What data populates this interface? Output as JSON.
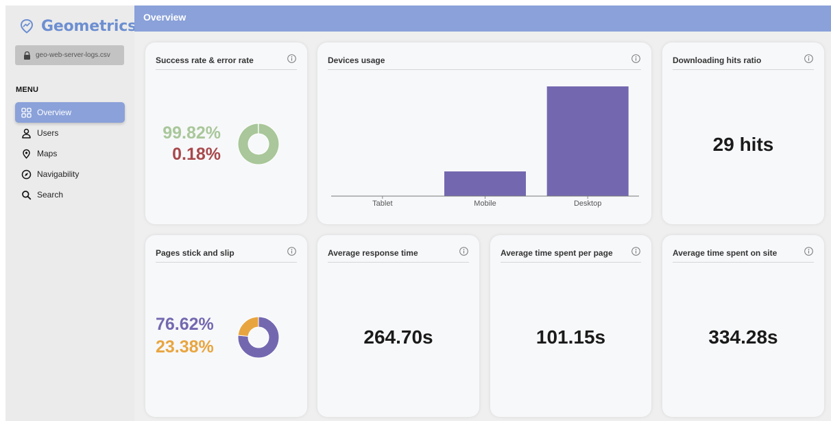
{
  "app": {
    "brand": "Geometrics",
    "file_name": "geo-web-server-logs.csv",
    "menu_heading": "MENU"
  },
  "sidebar": {
    "items": [
      {
        "label": "Overview",
        "icon": "grid-icon",
        "active": true
      },
      {
        "label": "Users",
        "icon": "user-icon",
        "active": false
      },
      {
        "label": "Maps",
        "icon": "map-pin-icon",
        "active": false
      },
      {
        "label": "Navigability",
        "icon": "compass-icon",
        "active": false
      },
      {
        "label": "Search",
        "icon": "search-icon",
        "active": false
      }
    ]
  },
  "header": {
    "title": "Overview"
  },
  "cards": {
    "success": {
      "title": "Success rate & error rate",
      "success_rate": "99.82%",
      "error_rate": "0.18%"
    },
    "devices": {
      "title": "Devices usage"
    },
    "downloading": {
      "title": "Downloading hits ratio",
      "value": "29 hits"
    },
    "pages": {
      "title": "Pages stick and slip",
      "stick": "76.62%",
      "slip": "23.38%"
    },
    "response": {
      "title": "Average response time",
      "value": "264.70s"
    },
    "time_per_page": {
      "title": "Average time spent per page",
      "value": "101.15s"
    },
    "time_on_site": {
      "title": "Average time spent on site",
      "value": "334.28s"
    }
  },
  "colors": {
    "brand": "#6d8fd1",
    "header": "#8aa1d9",
    "success": "#a9c79a",
    "error": "#a8484b",
    "stick": "#7368b0",
    "slip": "#e8a53f",
    "bar": "#7368b0"
  },
  "chart_data": [
    {
      "type": "bar",
      "categories": [
        "Tablet",
        "Mobile",
        "Desktop"
      ],
      "values": [
        0,
        22.5,
        100
      ],
      "ylim": [
        0,
        100
      ]
    },
    {
      "type": "pie",
      "categories": [
        "Success",
        "Error"
      ],
      "values": [
        99.82,
        0.18
      ]
    },
    {
      "type": "pie",
      "categories": [
        "Stick",
        "Slip"
      ],
      "values": [
        76.62,
        23.38
      ]
    }
  ]
}
